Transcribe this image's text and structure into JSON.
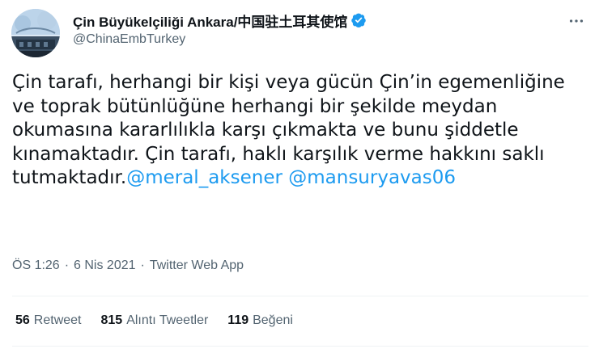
{
  "account": {
    "display_name": "Çin Büyükelçiliği Ankara/中国驻土耳其使馆",
    "handle": "@ChinaEmbTurkey",
    "verified_icon": "verified-badge-icon",
    "avatar_icon": "embassy-avatar"
  },
  "more_icon": "more-options-icon",
  "tweet": {
    "body": "Çin tarafı, herhangi bir kişi veya gücün Çin’in egemenliğine ve toprak bütünlüğüne herhangi bir şekilde meydan okumasına kararlılıkla karşı çıkmakta ve bunu şiddetle kınamaktadır. Çin tarafı, haklı karşılık verme hakkını saklı tutmaktadır.",
    "mentions": [
      "@meral_aksener",
      "@mansuryavas06"
    ]
  },
  "meta": {
    "time": "ÖS 1:26",
    "separator1": "·",
    "date": "6 Nis 2021",
    "separator2": "·",
    "source": "Twitter Web App"
  },
  "stats": {
    "retweets_count": "56",
    "retweets_label": "Retweet",
    "quotes_count": "815",
    "quotes_label": "Alıntı Tweetler",
    "likes_count": "119",
    "likes_label": "Beğeni"
  },
  "colors": {
    "accent": "#1d9bf0",
    "text_primary": "#0f1419",
    "text_secondary": "#536471"
  }
}
